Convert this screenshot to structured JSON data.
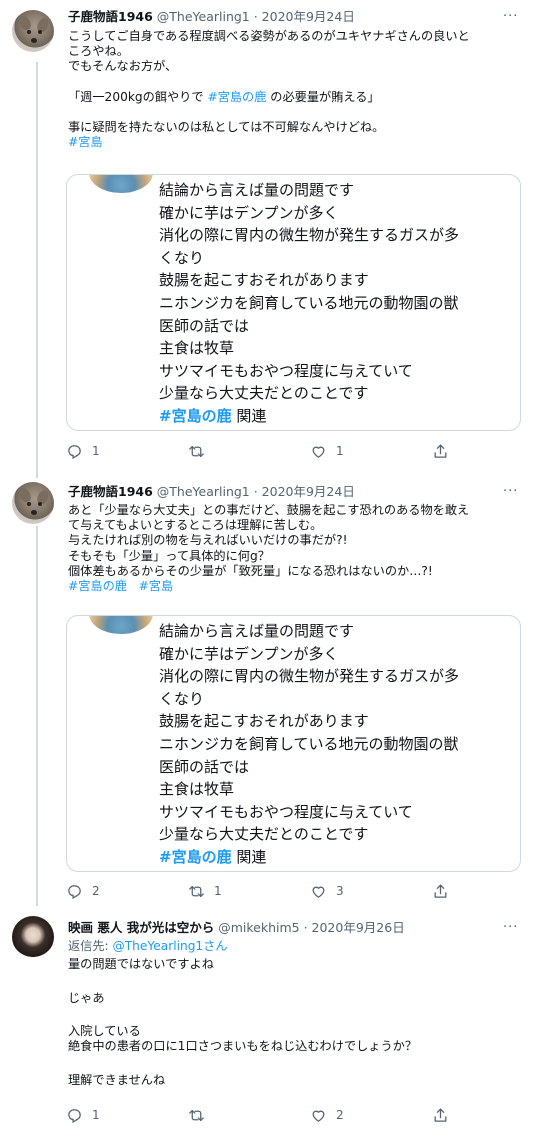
{
  "tweets": [
    {
      "author_name": "子鹿物語1946",
      "handle": "@TheYearling1",
      "date": "2020年9月24日",
      "text_lines": [
        "こうしてご自身である程度調べる姿勢があるのがユキヤナギさんの良いと",
        "ころやね。",
        "でもそんなお方が、",
        "",
        "「週一200kgの餌やりで "
      ],
      "inline_tag": "#宮島の鹿",
      "inline_after": " の必要量が賄える」",
      "text_lines_after": [
        "",
        "事に疑問を持たないのは私としては不可解なんやけどね。"
      ],
      "trailing_tag": "#宮島",
      "actions": {
        "reply": "1",
        "retweet": "",
        "like": "1"
      }
    },
    {
      "author_name": "子鹿物語1946",
      "handle": "@TheYearling1",
      "date": "2020年9月24日",
      "text_lines": [
        "あと「少量なら大丈夫」との事だけど、鼓腸を起こす恐れのある物を敢え",
        "て与えてもよいとするところは理解に苦しむ。",
        "与えたければ別の物を与えればいいだけの事だが?!",
        "そもそも「少量」って具体的に何g？",
        "個体差もあるからその少量が「致死量」になる恐れはないのか…?!"
      ],
      "trailing_tags": [
        "#宮島の鹿",
        "#宮島"
      ],
      "actions": {
        "reply": "2",
        "retweet": "1",
        "like": "3"
      }
    },
    {
      "author_name": "映画 悪人 我が光は空から",
      "handle": "@mikekhim5",
      "date": "2020年9月26日",
      "reply_prefix": "返信先: ",
      "reply_handle": "@TheYearling1",
      "reply_suffix": "さん",
      "text_lines": [
        "量の問題ではないですよね",
        "",
        "じゃあ",
        "",
        "入院している",
        "絶食中の患者の口に1口さつまいもをねじ込むわけでしょうか？",
        "",
        "理解できませんね"
      ],
      "actions": {
        "reply": "1",
        "retweet": "",
        "like": "2"
      }
    }
  ],
  "quote": {
    "lines": [
      "結論から言えば量の問題です",
      "確かに芋はデンプンが多く",
      "消化の際に胃内の微生物が発生するガスが多",
      "くなり",
      "鼓腸を起こすおそれがあります",
      "ニホンジカを飼育している地元の動物園の獣",
      "医師の話では",
      "主食は牧草",
      "サツマイモもおやつ程度に与えていて",
      "少量なら大丈夫だとのことです"
    ],
    "tag": "#宮島の鹿",
    "tag_suffix": " 関連"
  },
  "ui": {
    "separator": " · ",
    "more_label": "···"
  }
}
